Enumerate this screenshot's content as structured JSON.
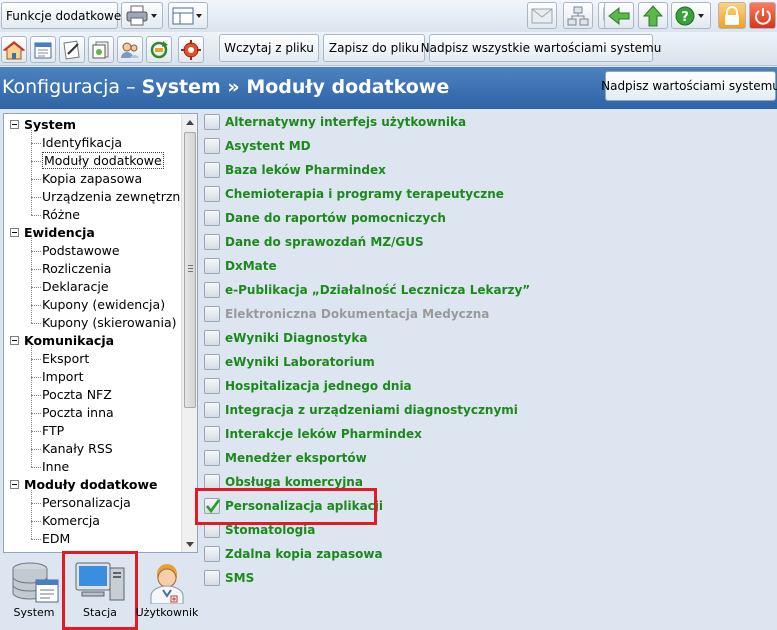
{
  "toolbar": {
    "funkcje_label": "Funkcje dodatkowe",
    "import_label": "Wczytaj z pliku",
    "export_label": "Zapisz do pliku",
    "overwrite_all_label": "Nadpisz wszystkie wartościami systemu"
  },
  "header": {
    "title_prefix": "Konfiguracja – ",
    "title_section": "System",
    "title_sep": " » ",
    "title_page": "Moduły dodatkowe",
    "overwrite_label": "Nadpisz wartościami systemu"
  },
  "tree": {
    "groups": [
      {
        "label": "System",
        "items": [
          "Identyfikacja",
          "Moduły dodatkowe",
          "Kopia zapasowa",
          "Urządzenia zewnętrzne",
          "Różne"
        ]
      },
      {
        "label": "Ewidencja",
        "items": [
          "Podstawowe",
          "Rozliczenia",
          "Deklaracje",
          "Kupony (ewidencja)",
          "Kupony (skierowania)"
        ]
      },
      {
        "label": "Komunikacja",
        "items": [
          "Eksport",
          "Import",
          "Poczta NFZ",
          "Poczta inna",
          "FTP",
          "Kanały RSS",
          "Inne"
        ]
      },
      {
        "label": "Moduły dodatkowe",
        "items": [
          "Personalizacja",
          "Komercja",
          "EDM"
        ]
      }
    ],
    "selected": "Moduły dodatkowe"
  },
  "modules": [
    {
      "label": "Alternatywny interfejs użytkownika",
      "checked": false,
      "enabled": true
    },
    {
      "label": "Asystent MD",
      "checked": false,
      "enabled": true
    },
    {
      "label": "Baza leków Pharmindex",
      "checked": false,
      "enabled": true
    },
    {
      "label": "Chemioterapia i programy terapeutyczne",
      "checked": false,
      "enabled": true
    },
    {
      "label": "Dane do raportów pomocniczych",
      "checked": false,
      "enabled": true
    },
    {
      "label": "Dane do sprawozdań MZ/GUS",
      "checked": false,
      "enabled": true
    },
    {
      "label": "DxMate",
      "checked": false,
      "enabled": true
    },
    {
      "label": "e-Publikacja „Działalność Lecznicza Lekarzy”",
      "checked": false,
      "enabled": true
    },
    {
      "label": "Elektroniczna Dokumentacja Medyczna",
      "checked": false,
      "enabled": false
    },
    {
      "label": "eWyniki Diagnostyka",
      "checked": false,
      "enabled": true
    },
    {
      "label": "eWyniki Laboratorium",
      "checked": false,
      "enabled": true
    },
    {
      "label": "Hospitalizacja jednego dnia",
      "checked": false,
      "enabled": true
    },
    {
      "label": "Integracja z urządzeniami diagnostycznymi",
      "checked": false,
      "enabled": true
    },
    {
      "label": "Interakcje leków Pharmindex",
      "checked": false,
      "enabled": true
    },
    {
      "label": "Menedżer eksportów",
      "checked": false,
      "enabled": true
    },
    {
      "label": "Obsługa komercyjna",
      "checked": false,
      "enabled": true
    },
    {
      "label": "Personalizacja aplikacji",
      "checked": true,
      "enabled": true
    },
    {
      "label": "Stomatologia",
      "checked": false,
      "enabled": true
    },
    {
      "label": "Zdalna kopia zapasowa",
      "checked": false,
      "enabled": true
    },
    {
      "label": "SMS",
      "checked": false,
      "enabled": true
    }
  ],
  "bottom_tabs": [
    {
      "label": "System",
      "icon": "database-icon"
    },
    {
      "label": "Stacja",
      "icon": "computer-icon",
      "active": true
    },
    {
      "label": "Użytkownik",
      "icon": "doctor-icon"
    }
  ],
  "colors": {
    "title_bar": "#3a6fb0",
    "module_text": "#1b8a1b",
    "disabled_text": "#9a9a9a",
    "highlight": "#e01b24"
  }
}
